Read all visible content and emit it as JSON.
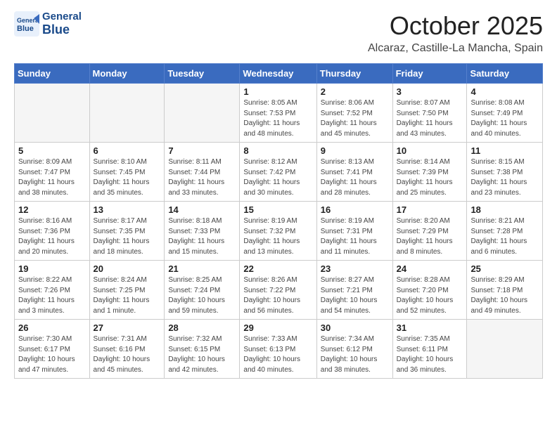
{
  "header": {
    "logo_general": "General",
    "logo_blue": "Blue",
    "month": "October 2025",
    "location": "Alcaraz, Castille-La Mancha, Spain"
  },
  "weekdays": [
    "Sunday",
    "Monday",
    "Tuesday",
    "Wednesday",
    "Thursday",
    "Friday",
    "Saturday"
  ],
  "weeks": [
    [
      {
        "day": "",
        "info": ""
      },
      {
        "day": "",
        "info": ""
      },
      {
        "day": "",
        "info": ""
      },
      {
        "day": "1",
        "info": "Sunrise: 8:05 AM\nSunset: 7:53 PM\nDaylight: 11 hours\nand 48 minutes."
      },
      {
        "day": "2",
        "info": "Sunrise: 8:06 AM\nSunset: 7:52 PM\nDaylight: 11 hours\nand 45 minutes."
      },
      {
        "day": "3",
        "info": "Sunrise: 8:07 AM\nSunset: 7:50 PM\nDaylight: 11 hours\nand 43 minutes."
      },
      {
        "day": "4",
        "info": "Sunrise: 8:08 AM\nSunset: 7:49 PM\nDaylight: 11 hours\nand 40 minutes."
      }
    ],
    [
      {
        "day": "5",
        "info": "Sunrise: 8:09 AM\nSunset: 7:47 PM\nDaylight: 11 hours\nand 38 minutes."
      },
      {
        "day": "6",
        "info": "Sunrise: 8:10 AM\nSunset: 7:45 PM\nDaylight: 11 hours\nand 35 minutes."
      },
      {
        "day": "7",
        "info": "Sunrise: 8:11 AM\nSunset: 7:44 PM\nDaylight: 11 hours\nand 33 minutes."
      },
      {
        "day": "8",
        "info": "Sunrise: 8:12 AM\nSunset: 7:42 PM\nDaylight: 11 hours\nand 30 minutes."
      },
      {
        "day": "9",
        "info": "Sunrise: 8:13 AM\nSunset: 7:41 PM\nDaylight: 11 hours\nand 28 minutes."
      },
      {
        "day": "10",
        "info": "Sunrise: 8:14 AM\nSunset: 7:39 PM\nDaylight: 11 hours\nand 25 minutes."
      },
      {
        "day": "11",
        "info": "Sunrise: 8:15 AM\nSunset: 7:38 PM\nDaylight: 11 hours\nand 23 minutes."
      }
    ],
    [
      {
        "day": "12",
        "info": "Sunrise: 8:16 AM\nSunset: 7:36 PM\nDaylight: 11 hours\nand 20 minutes."
      },
      {
        "day": "13",
        "info": "Sunrise: 8:17 AM\nSunset: 7:35 PM\nDaylight: 11 hours\nand 18 minutes."
      },
      {
        "day": "14",
        "info": "Sunrise: 8:18 AM\nSunset: 7:33 PM\nDaylight: 11 hours\nand 15 minutes."
      },
      {
        "day": "15",
        "info": "Sunrise: 8:19 AM\nSunset: 7:32 PM\nDaylight: 11 hours\nand 13 minutes."
      },
      {
        "day": "16",
        "info": "Sunrise: 8:19 AM\nSunset: 7:31 PM\nDaylight: 11 hours\nand 11 minutes."
      },
      {
        "day": "17",
        "info": "Sunrise: 8:20 AM\nSunset: 7:29 PM\nDaylight: 11 hours\nand 8 minutes."
      },
      {
        "day": "18",
        "info": "Sunrise: 8:21 AM\nSunset: 7:28 PM\nDaylight: 11 hours\nand 6 minutes."
      }
    ],
    [
      {
        "day": "19",
        "info": "Sunrise: 8:22 AM\nSunset: 7:26 PM\nDaylight: 11 hours\nand 3 minutes."
      },
      {
        "day": "20",
        "info": "Sunrise: 8:24 AM\nSunset: 7:25 PM\nDaylight: 11 hours\nand 1 minute."
      },
      {
        "day": "21",
        "info": "Sunrise: 8:25 AM\nSunset: 7:24 PM\nDaylight: 10 hours\nand 59 minutes."
      },
      {
        "day": "22",
        "info": "Sunrise: 8:26 AM\nSunset: 7:22 PM\nDaylight: 10 hours\nand 56 minutes."
      },
      {
        "day": "23",
        "info": "Sunrise: 8:27 AM\nSunset: 7:21 PM\nDaylight: 10 hours\nand 54 minutes."
      },
      {
        "day": "24",
        "info": "Sunrise: 8:28 AM\nSunset: 7:20 PM\nDaylight: 10 hours\nand 52 minutes."
      },
      {
        "day": "25",
        "info": "Sunrise: 8:29 AM\nSunset: 7:18 PM\nDaylight: 10 hours\nand 49 minutes."
      }
    ],
    [
      {
        "day": "26",
        "info": "Sunrise: 7:30 AM\nSunset: 6:17 PM\nDaylight: 10 hours\nand 47 minutes."
      },
      {
        "day": "27",
        "info": "Sunrise: 7:31 AM\nSunset: 6:16 PM\nDaylight: 10 hours\nand 45 minutes."
      },
      {
        "day": "28",
        "info": "Sunrise: 7:32 AM\nSunset: 6:15 PM\nDaylight: 10 hours\nand 42 minutes."
      },
      {
        "day": "29",
        "info": "Sunrise: 7:33 AM\nSunset: 6:13 PM\nDaylight: 10 hours\nand 40 minutes."
      },
      {
        "day": "30",
        "info": "Sunrise: 7:34 AM\nSunset: 6:12 PM\nDaylight: 10 hours\nand 38 minutes."
      },
      {
        "day": "31",
        "info": "Sunrise: 7:35 AM\nSunset: 6:11 PM\nDaylight: 10 hours\nand 36 minutes."
      },
      {
        "day": "",
        "info": ""
      }
    ]
  ]
}
